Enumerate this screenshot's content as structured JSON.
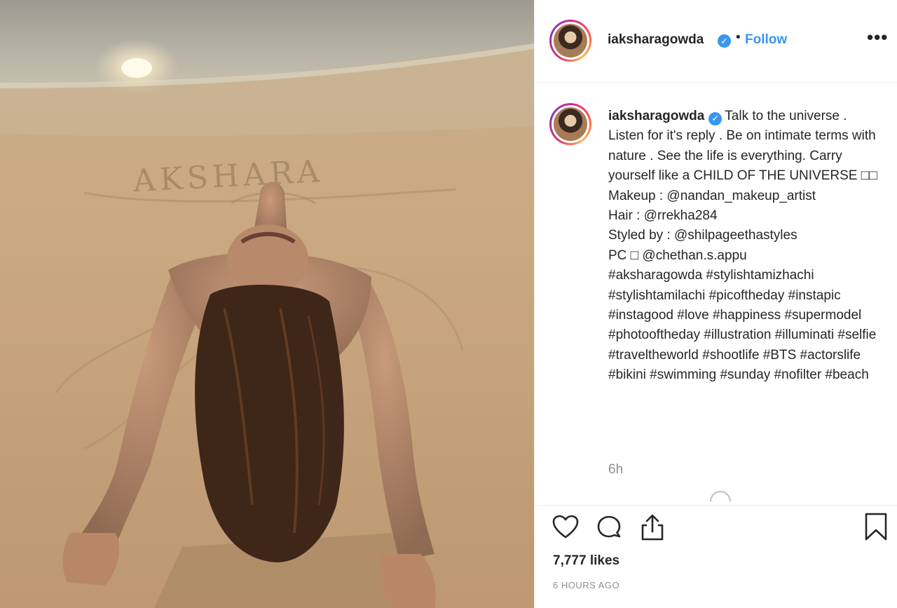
{
  "header": {
    "username": "iaksharagowda",
    "separator": "•",
    "follow_label": "Follow",
    "more_label": "•••"
  },
  "caption": {
    "username": "iaksharagowda",
    "text": "Talk to the universe . Listen for it's reply . Be on intimate terms with nature . See the life is everything. Carry yourself like a CHILD OF THE UNIVERSE □□ Makeup : @nandan_makeup_artist\nHair : @rrekha284\nStyled by : @shilpageethastyles\nPC □ @chethan.s.appu\n#aksharagowda #stylishtamizhachi #stylishtamilachi #picoftheday #instapic #instagood #love #happiness #supermodel #photooftheday #illustration #illuminati #selfie #traveltheworld #shootlife #BTS #actorslife #bikini #swimming #sunday #nofilter #beach",
    "time_relative": "6h"
  },
  "actions": {
    "likes": "7,777 likes",
    "posted_ago": "6 HOURS AGO"
  },
  "photo": {
    "sand_writing": "AKSHARA"
  },
  "colors": {
    "link": "#3897f0",
    "muted": "#8e8e8e",
    "text": "#262626",
    "border": "#efefef"
  },
  "icons": [
    "verified-badge-icon",
    "more-options-icon",
    "heart-icon",
    "comment-icon",
    "share-icon",
    "bookmark-icon",
    "loading-spinner-icon"
  ]
}
